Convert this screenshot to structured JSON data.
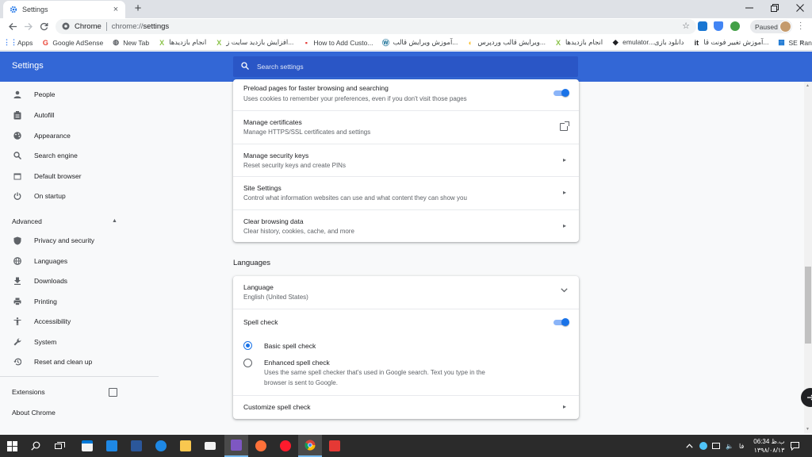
{
  "tab": {
    "title": "Settings"
  },
  "toolbar": {
    "site_label": "Chrome",
    "url_scheme": "chrome://",
    "url_path": "settings",
    "profile_status": "Paused"
  },
  "bookmarks": [
    {
      "label": "Apps",
      "icon": "apps-grid-icon",
      "color": "#4285f4"
    },
    {
      "label": "Google AdSense",
      "icon": "google-g-icon",
      "color": "#ea4335"
    },
    {
      "label": "New Tab",
      "icon": "globe-icon",
      "color": "#5f6368"
    },
    {
      "label": "انجام بازدیدها",
      "icon": "x-icon",
      "color": "#8bc34a"
    },
    {
      "label": "افزایش بازدید سایت ز...",
      "icon": "x-icon",
      "color": "#8bc34a"
    },
    {
      "label": "How to Add Custo...",
      "icon": "page-icon",
      "color": "#e53935"
    },
    {
      "label": "آموزش ویرایش قالب...",
      "icon": "wp-icon",
      "color": "#21759b"
    },
    {
      "label": "ویرایش قالب وردپرس...",
      "icon": "moon-icon",
      "color": "#fbc02d"
    },
    {
      "label": "انجام بازدیدها",
      "icon": "x-icon",
      "color": "#8bc34a"
    },
    {
      "label": "emulator...دانلود بازی",
      "icon": "gamepad-icon",
      "color": "#202124"
    },
    {
      "label": "آموزش تغییر فونت قا...",
      "icon": "it-icon",
      "color": "#202124"
    },
    {
      "label": "SE Ranking",
      "icon": "chart-icon",
      "color": "#1976d2"
    }
  ],
  "header": {
    "title": "Settings",
    "search_placeholder": "Search settings"
  },
  "sidebar": {
    "items": [
      {
        "label": "People",
        "icon": "person-icon"
      },
      {
        "label": "Autofill",
        "icon": "clipboard-icon"
      },
      {
        "label": "Appearance",
        "icon": "palette-icon"
      },
      {
        "label": "Search engine",
        "icon": "search-icon"
      },
      {
        "label": "Default browser",
        "icon": "browser-icon"
      },
      {
        "label": "On startup",
        "icon": "power-icon"
      }
    ],
    "advanced_label": "Advanced",
    "advanced_items": [
      {
        "label": "Privacy and security",
        "icon": "shield-icon"
      },
      {
        "label": "Languages",
        "icon": "globe-icon"
      },
      {
        "label": "Downloads",
        "icon": "download-icon"
      },
      {
        "label": "Printing",
        "icon": "printer-icon"
      },
      {
        "label": "Accessibility",
        "icon": "accessibility-icon"
      },
      {
        "label": "System",
        "icon": "wrench-icon"
      },
      {
        "label": "Reset and clean up",
        "icon": "history-icon"
      }
    ],
    "extensions_label": "Extensions",
    "about_label": "About Chrome"
  },
  "privacy_card": {
    "rows": [
      {
        "title": "Preload pages for faster browsing and searching",
        "subtitle": "Uses cookies to remember your preferences, even if you don't visit those pages",
        "control": "toggle-on"
      },
      {
        "title": "Manage certificates",
        "subtitle": "Manage HTTPS/SSL certificates and settings",
        "control": "open-in-new"
      },
      {
        "title": "Manage security keys",
        "subtitle": "Reset security keys and create PINs",
        "control": "arrow"
      },
      {
        "title": "Site Settings",
        "subtitle": "Control what information websites can use and what content they can show you",
        "control": "arrow"
      },
      {
        "title": "Clear browsing data",
        "subtitle": "Clear history, cookies, cache, and more",
        "control": "arrow"
      }
    ]
  },
  "languages": {
    "section_title": "Languages",
    "language_title": "Language",
    "language_value": "English (United States)",
    "spell_check_title": "Spell check",
    "spell_check_on": true,
    "basic_label": "Basic spell check",
    "basic_selected": true,
    "enhanced_label": "Enhanced spell check",
    "enhanced_desc_1": "Uses the same spell checker that's used in Google search. Text you type in the",
    "enhanced_desc_2": "browser is sent to Google.",
    "customize_label": "Customize spell check"
  },
  "taskbar": {
    "time": "06:34 ب.ظ",
    "date": "۱۳۹۸/۰۸/۱۳",
    "lang": "فا",
    "accent": "#76b9ed"
  },
  "colors": {
    "header_blue": "#3367d6",
    "search_blue": "#2a56c6",
    "toggle_blue": "#1a73e8"
  }
}
